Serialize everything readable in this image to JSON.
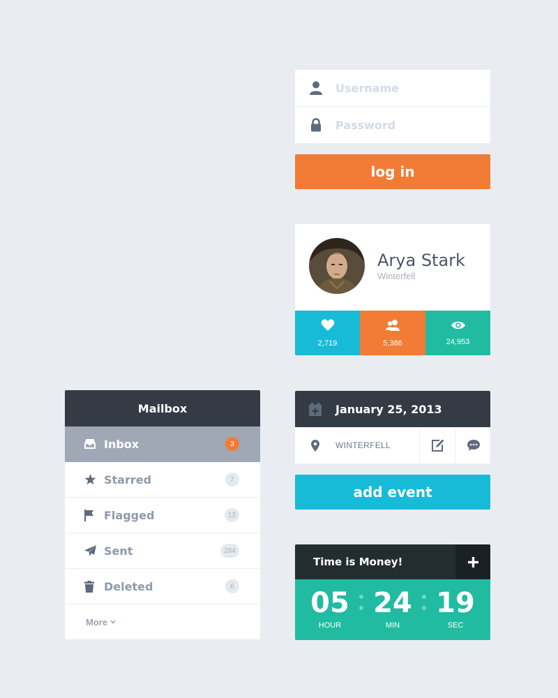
{
  "login": {
    "username_placeholder": "Username",
    "password_placeholder": "Password",
    "button_label": "log in",
    "accent": "#f27b36"
  },
  "profile": {
    "name": "Arya Stark",
    "location": "Winterfell",
    "stats": [
      {
        "icon": "heart-icon",
        "value": "2,719",
        "color": "#17bbd7"
      },
      {
        "icon": "users-icon",
        "value": "5,386",
        "color": "#f27b36"
      },
      {
        "icon": "eye-icon",
        "value": "24,953",
        "color": "#21bba2"
      }
    ]
  },
  "mailbox": {
    "title": "Mailbox",
    "items": [
      {
        "label": "Inbox",
        "count": "3",
        "icon": "inbox-icon",
        "active": true
      },
      {
        "label": "Starred",
        "count": "7",
        "icon": "star-icon"
      },
      {
        "label": "Flagged",
        "count": "13",
        "icon": "flag-icon"
      },
      {
        "label": "Sent",
        "count": "284",
        "icon": "send-icon"
      },
      {
        "label": "Deleted",
        "count": "6",
        "icon": "trash-icon"
      }
    ],
    "more_label": "More"
  },
  "event": {
    "date": "January 25, 2013",
    "location": "WINTERFELL",
    "add_button": "add event",
    "accent": "#17bbd7"
  },
  "timer": {
    "title": "Time is Money!",
    "hours": "05",
    "hours_label": "HOUR",
    "minutes": "24",
    "minutes_label": "MIN",
    "seconds": "19",
    "seconds_label": "SEC",
    "accent": "#21bba2"
  }
}
